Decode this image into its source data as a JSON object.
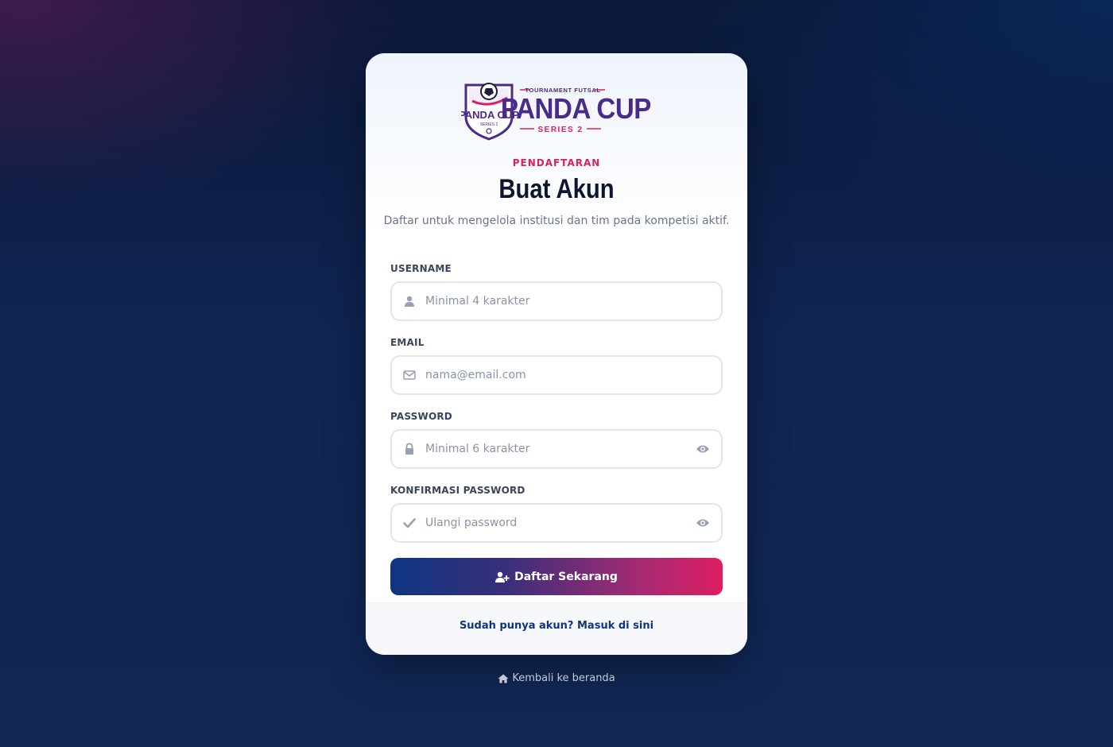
{
  "brand": {
    "logo_title": "PANDA CUP",
    "logo_top": "TOURNAMENT FUTSAL",
    "logo_series": "SERIES 2",
    "colors": {
      "primary": "#0e3582",
      "accent": "#dd1e63",
      "purple": "#4a2a8a"
    }
  },
  "header": {
    "kicker": "PENDAFTARAN",
    "title": "Buat Akun",
    "subtitle": "Daftar untuk mengelola institusi dan tim pada kompetisi aktif."
  },
  "form": {
    "username": {
      "label": "USERNAME",
      "placeholder": "Minimal 4 karakter",
      "icon": "user-icon"
    },
    "email": {
      "label": "EMAIL",
      "placeholder": "nama@email.com",
      "icon": "envelope-icon"
    },
    "password": {
      "label": "PASSWORD",
      "placeholder": "Minimal 6 karakter",
      "icon": "lock-icon"
    },
    "confirm": {
      "label": "KONFIRMASI PASSWORD",
      "placeholder": "Ulangi password",
      "icon": "check-icon"
    },
    "submit_label": "Daftar Sekarang"
  },
  "footer": {
    "login_link": "Sudah punya akun? Masuk di sini"
  },
  "back_link": "Kembali ke beranda"
}
